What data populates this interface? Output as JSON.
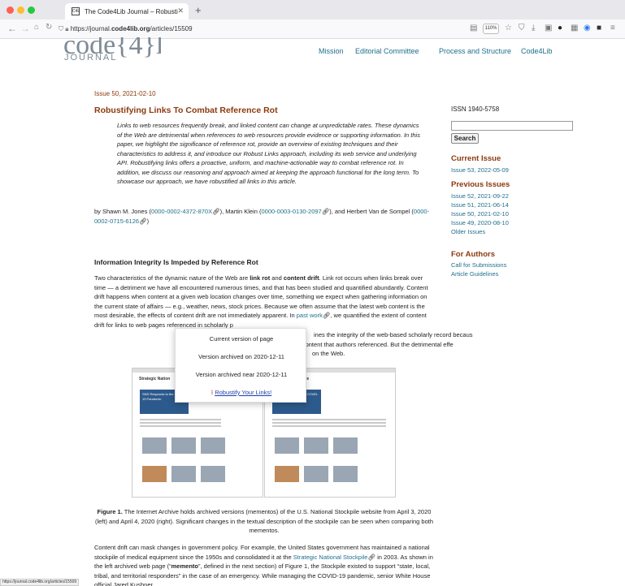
{
  "browser": {
    "tab_title": "The Code4Lib Journal – Robusti",
    "tab_favicon": "C4L",
    "url_prefix": "https://journal.",
    "url_domain": "code4lib.org",
    "url_path": "/articles/15509",
    "zoom": "110%",
    "status_url": "https://journal.code4lib.org/articles/15509"
  },
  "logo": {
    "main": "code{4}lib",
    "sub": "JOURNAL"
  },
  "topnav": [
    "Mission",
    "Editorial Committee",
    "Process and Structure",
    "Code4Lib"
  ],
  "article": {
    "issue_date": "Issue 50, 2021-02-10",
    "title": "Robustifying Links To Combat Reference Rot",
    "abstract": "Links to web resources frequently break, and linked content can change at unpredictable rates. These dynamics of the Web are detrimental when references to web resources provide evidence or supporting information. In this paper, we highlight the significance of reference rot, provide an overview of existing techniques and their characteristics to address it, and introduce our Robust Links approach, including its web service and underlying API. Robustifying links offers a proactive, uniform, and machine-actionable way to combat reference rot. In addition, we discuss our reasoning and approach aimed at keeping the approach functional for the long term. To showcase our approach, we have robustified all links in this article.",
    "by": "by Shawn M. Jones (",
    "orcid1": "0000-0002-4372-870X",
    "sep1": "), Martin Klein (",
    "orcid2": "0000-0003-0130-2097",
    "sep2": "), and Herbert Van de Sompel (",
    "orcid3": "0000-0002-0715-6126",
    "end": ")",
    "section_title": "Information Integrity Is Impeded by Reference Rot",
    "p1_a": "Two characteristics of the dynamic nature of the Web are ",
    "p1_b": "link rot",
    "p1_c": " and ",
    "p1_d": "content drift",
    "p1_e": ". Link rot occurs when links break over time — a detriment we have all encountered numerous times, and that has been studied and quantified abundantly. Content drift happens when content at a given web location changes over time, something we expect when gathering information on the current state of affairs — e.g., weather, news, stock prices. Because we often assume that the latest web content is the most desirable, the effects of content drift are not immediately apparent. In ",
    "p1_link": "past work",
    "p1_f": ", we quantified the extent of content drift for links to web pages referenced in scholarly p",
    "p1_g": "ines the integrity of the web-based scholarly record becaus",
    "p1_h": " web content that authors referenced. But the detrimental effe",
    "p1_i": "on the Web.",
    "caption_bold": "Figure 1.",
    "caption": " The Internet Archive holds archived versions (mementos) of the U.S. National Stockpile website from April 3, 2020 (left) and April 4, 2020 (right). Significant changes in the textual description of the stockpile can be seen when comparing both mementos.",
    "p2_a": "Content drift can mask changes in government policy. For example, the United States government has maintained a national stockpile of medical equipment since the 1950s and consolidated it at the ",
    "p2_link": "Strategic National Stockpile",
    "p2_b": " in 2003. As shown in the left archived web page (“",
    "p2_bold": "memento",
    "p2_c": "”, defined in the next section) of Figure 1, the Stockpile existed to support “state, local, tribal, and territorial responders” in the case of an emergency. While managing the COVID-19 pandemic, senior White House official Jared Kushner"
  },
  "popup": {
    "current": "Current version of page",
    "archived_on": "Version archived on 2020-12-11",
    "archived_near": "Version archived near 2020-12-11",
    "robustify": "Robustify Your Links!"
  },
  "sidebar": {
    "issn": "ISSN 1940-5758",
    "search_button": "Search",
    "current_issue_heading": "Current Issue",
    "current_issue": "Issue 53, 2022-05-09",
    "previous_heading": "Previous Issues",
    "previous": [
      "Issue 52, 2021-09-22",
      "Issue 51, 2021-06-14",
      "Issue 50, 2021-02-10",
      "Issue 49, 2020-08-10",
      "Older Issues"
    ],
    "authors_heading": "For Authors",
    "authors": [
      "Call for Submissions",
      "Article Guidelines"
    ]
  },
  "figure": {
    "left_header": "Strategic Nation",
    "left_hero": "SNS Responds to the COVID-19 Pandemic",
    "right_header": "ckpile",
    "right_hero": "SNS Responds to the COVID-19 Pandemic"
  }
}
